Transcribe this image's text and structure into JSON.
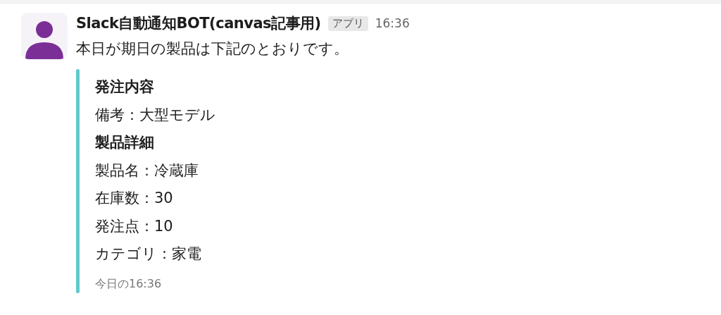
{
  "message": {
    "sender": "Slack自動通知BOT(canvas記事用)",
    "badge": "アプリ",
    "time": "16:36",
    "text": "本日が期日の製品は下記のとおりです。",
    "attachment": {
      "lines": [
        {
          "kind": "heading",
          "text": "発注内容"
        },
        {
          "kind": "field",
          "text": "備考：大型モデル"
        },
        {
          "kind": "heading",
          "text": "製品詳細"
        },
        {
          "kind": "field",
          "text": "製品名：冷蔵庫"
        },
        {
          "kind": "field",
          "text": "在庫数：30"
        },
        {
          "kind": "field",
          "text": "発注点：10"
        },
        {
          "kind": "field",
          "text": "カテゴリ：家電"
        }
      ],
      "footer": "今日の16:36"
    }
  }
}
